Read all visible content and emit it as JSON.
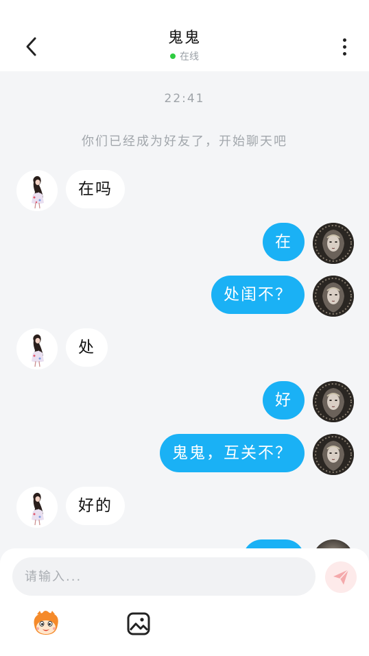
{
  "header": {
    "title": "鬼鬼",
    "status": "在线",
    "status_color": "#2ecc40"
  },
  "chat": {
    "time_separator": "22:41",
    "system_message": "你们已经成为好友了，开始聊天吧",
    "messages": [
      {
        "side": "left",
        "text": "在吗",
        "avatar": "girl-avatar"
      },
      {
        "side": "right",
        "text": "在",
        "avatar": "dark-avatar"
      },
      {
        "side": "right",
        "text": "处闺不？",
        "avatar": "dark-avatar"
      },
      {
        "side": "left",
        "text": "处",
        "avatar": "girl-avatar"
      },
      {
        "side": "right",
        "text": "好",
        "avatar": "dark-avatar"
      },
      {
        "side": "right",
        "text": "鬼鬼，互关不？",
        "avatar": "dark-avatar"
      },
      {
        "side": "left",
        "text": "好的",
        "avatar": "girl-avatar"
      }
    ],
    "bubble_colors": {
      "sent": "#1ab1f5",
      "received": "#ffffff"
    }
  },
  "composer": {
    "placeholder": "请输入...",
    "send_icon": "send-icon",
    "tools": [
      "emoji-icon",
      "image-icon"
    ]
  }
}
